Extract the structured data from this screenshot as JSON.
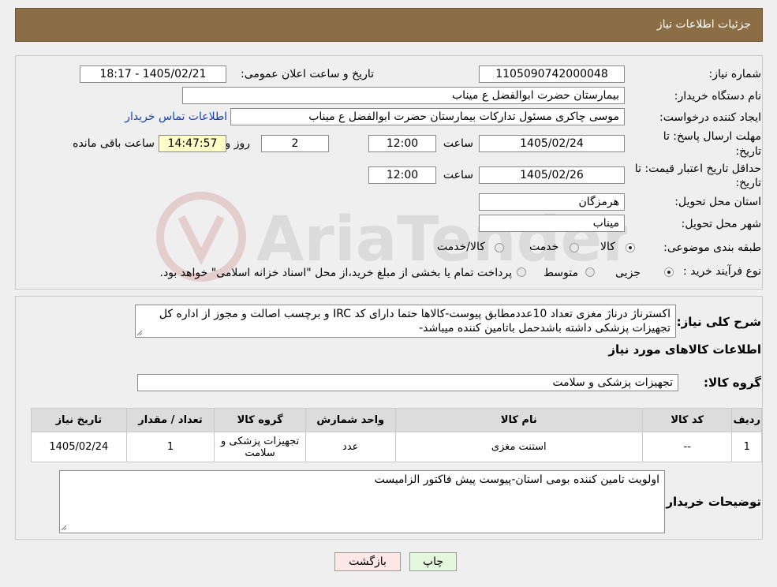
{
  "header": {
    "title": "جزئیات اطلاعات نیاز"
  },
  "form": {
    "need_number_label": "شماره نیاز:",
    "need_number": "1105090742000048",
    "announce_label": "تاریخ و ساعت اعلان عمومی:",
    "announce_value": "1405/02/21 - 18:17",
    "buyer_org_label": "نام دستگاه خریدار:",
    "buyer_org": "بیمارستان حضرت ابوالفضل ع  میناب",
    "creator_label": "ایجاد کننده درخواست:",
    "creator": "موسی چاکری مسئول تدارکات بیمارستان حضرت ابوالفضل ع  میناب",
    "contact_link": "اطلاعات تماس خریدار",
    "deadline_label_1": "مهلت ارسال پاسخ: تا",
    "deadline_label_2": "تاریخ:",
    "deadline_date": "1405/02/24",
    "time_label": "ساعت",
    "deadline_time": "12:00",
    "days_value": "2",
    "days_label": "روز و",
    "remaining_time": "14:47:57",
    "remaining_label": "ساعت باقی مانده",
    "validity_label_1": "حداقل تاریخ اعتبار قیمت: تا",
    "validity_label_2": "تاریخ:",
    "validity_date": "1405/02/26",
    "validity_time_label": "ساعت",
    "validity_time": "12:00",
    "province_label": "استان محل تحویل:",
    "province": "هرمزگان",
    "city_label": "شهر محل تحویل:",
    "city": "میناب",
    "category_label": "طبقه بندی موضوعی:",
    "category_options": [
      "کالا",
      "خدمت",
      "کالا/خدمت"
    ],
    "category_selected": 0,
    "purchase_label": "نوع فرآیند خرید :",
    "purchase_options": [
      "جزیی",
      "متوسط"
    ],
    "purchase_selected": 0,
    "purchase_note": "پرداخت تمام یا بخشی از مبلغ خرید،از محل \"اسناد خزانه اسلامی\" خواهد بود."
  },
  "watermark": {
    "text": "AriaTender.neT"
  },
  "summary": {
    "label": "شرح کلی نیاز:",
    "text": "اکسترناژ درناژ مغزی تعداد 10عددمطابق پیوست-کالاها حتما دارای کد IRC و برچسب اصالت و مجوز از اداره کل تجهیزات پزشکی داشته باشدحمل باتامین کننده میباشد-"
  },
  "goods_info": {
    "title": "اطلاعات کالاهای مورد نیاز",
    "group_label": "گروه کالا:",
    "group_value": "تجهیزات پزشکی و سلامت"
  },
  "table": {
    "headers": [
      "ردیف",
      "کد کالا",
      "نام کالا",
      "واحد شمارش",
      "گروه کالا",
      "تعداد / مقدار",
      "تاریخ نیاز"
    ],
    "rows": [
      [
        "1",
        "--",
        "استنت مغزی",
        "عدد",
        "تجهیزات پزشکی و سلامت",
        "1",
        "1405/02/24"
      ]
    ]
  },
  "buyer_notes": {
    "label": "توضیحات خریدار:",
    "text": "اولویت تامین کننده بومی استان-پیوست پیش فاکتور الزامیست"
  },
  "buttons": {
    "print": "چاپ",
    "back": "بازگشت"
  },
  "colors": {
    "header_bg": "#8c6e46",
    "yellow_box": "#ffffc8",
    "link": "#1a3fb5",
    "print_btn": "#e4f7dc",
    "back_btn": "#fde6e6"
  }
}
